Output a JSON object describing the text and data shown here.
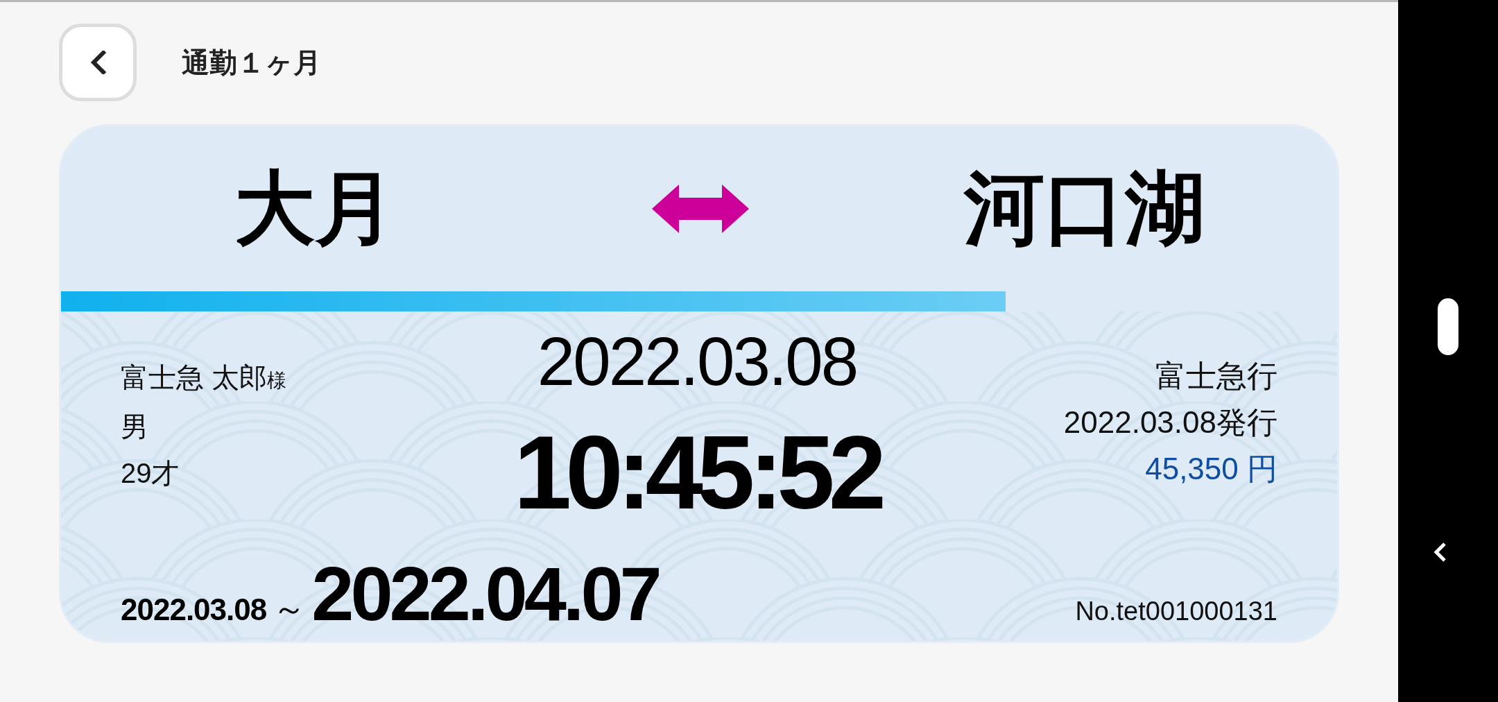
{
  "header": {
    "title": "通勤１ヶ月"
  },
  "ticket": {
    "from_station": "大月",
    "to_station": "河口湖",
    "validity_bar": {
      "level": 0.74
    },
    "passenger": {
      "name": "富士急 太郎",
      "honorific": "様",
      "gender": "男",
      "age": "29才"
    },
    "date": "2022.03.08",
    "time": "10:45:52",
    "issuer": "富士急行",
    "issue_date": "2022.03.08発行",
    "price": "45,350 円",
    "valid_from": "2022.03.08",
    "range_mark": "～",
    "valid_to": "2022.04.07",
    "number": "No.tet001000131"
  }
}
